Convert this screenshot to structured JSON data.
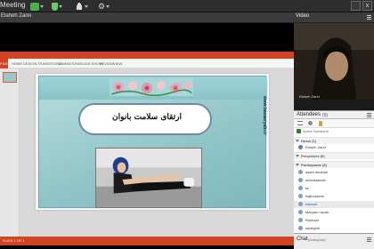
{
  "app": {
    "title": "Meeting"
  },
  "toolbar": {
    "mic_color": "#4caf50",
    "cam_color": "#6c6",
    "accent": "#d04423"
  },
  "window_controls": {
    "close": "x"
  },
  "share_pod": {
    "presenter": "Elaheh Zarei",
    "ppt": {
      "file_tab": "FILE",
      "tabs": [
        "HOME",
        "DESIGN",
        "TRANSITIONS",
        "ANIMATIONS",
        "SLIDE SHOW",
        "REVIEW",
        "VIEW"
      ],
      "status": "SLIDE 1 OF 1",
      "slide": {
        "title": "ارتقای سلامت بانوان",
        "side_url": "www.bazaaryabi.ir"
      }
    }
  },
  "video_pod": {
    "title": "Video",
    "camera_name": "Elaheh Zarei"
  },
  "attendees": {
    "title": "Attendees",
    "count": "(9)",
    "active_speakers_label": "Active Speakers",
    "groups": [
      {
        "label": "Hosts (1)",
        "members": [
          "Elaheh Zarei"
        ]
      },
      {
        "label": "Presenters (0)",
        "members": []
      },
      {
        "label": "Participants (8)",
        "members": [
          "azam moshari",
          "shamsrazabi",
          "fa",
          "hajihosseini",
          "Nahadi",
          "Maryam navab",
          "Rokhsar",
          "sadeghei"
        ]
      }
    ]
  },
  "chat": {
    "title": "Chat",
    "audience": "(Everyone)"
  }
}
